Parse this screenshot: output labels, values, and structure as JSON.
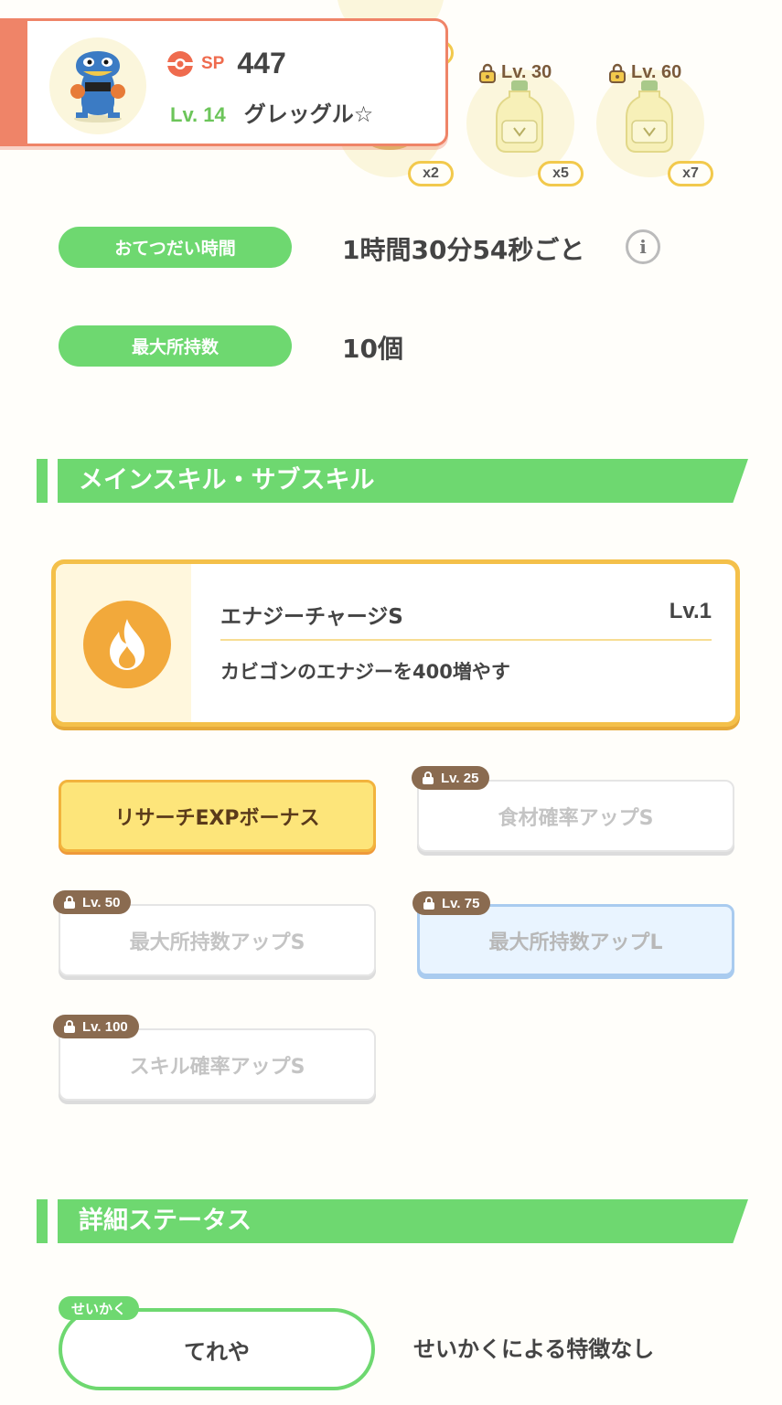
{
  "pokemon": {
    "sp_label": "SP",
    "sp_value": "447",
    "level_label": "Lv. 14",
    "name": "グレッグル☆"
  },
  "ingredients": [
    {
      "lock_label": "",
      "quantity": "x2"
    },
    {
      "lock_label": "Lv. 30",
      "quantity": "x5"
    },
    {
      "lock_label": "Lv. 60",
      "quantity": "x7"
    }
  ],
  "stats": {
    "help_time_label": "おてつだい時間",
    "help_time_value": "1時間30分54秒ごと",
    "max_carry_label": "最大所持数",
    "max_carry_value": "10個"
  },
  "skills_section": {
    "title": "メインスキル・サブスキル",
    "main_skill": {
      "name": "エナジーチャージS",
      "level": "Lv.1",
      "description": "カビゴンのエナジーを400増やす"
    },
    "sub_skills": [
      {
        "name": "リサーチEXPボーナス",
        "lock_label": ""
      },
      {
        "name": "食材確率アップS",
        "lock_label": "Lv. 25"
      },
      {
        "name": "最大所持数アップS",
        "lock_label": "Lv. 50"
      },
      {
        "name": "最大所持数アップL",
        "lock_label": "Lv. 75"
      },
      {
        "name": "スキル確率アップS",
        "lock_label": "Lv. 100"
      }
    ]
  },
  "details_section": {
    "title": "詳細ステータス",
    "nature_tag": "せいかく",
    "nature_value": "てれや",
    "nature_effect": "せいかくによる特徴なし"
  },
  "colors": {
    "green": "#6ed870",
    "orange": "#ef8468",
    "gold": "#f4c04a",
    "lock_brown": "#8a6b50"
  }
}
